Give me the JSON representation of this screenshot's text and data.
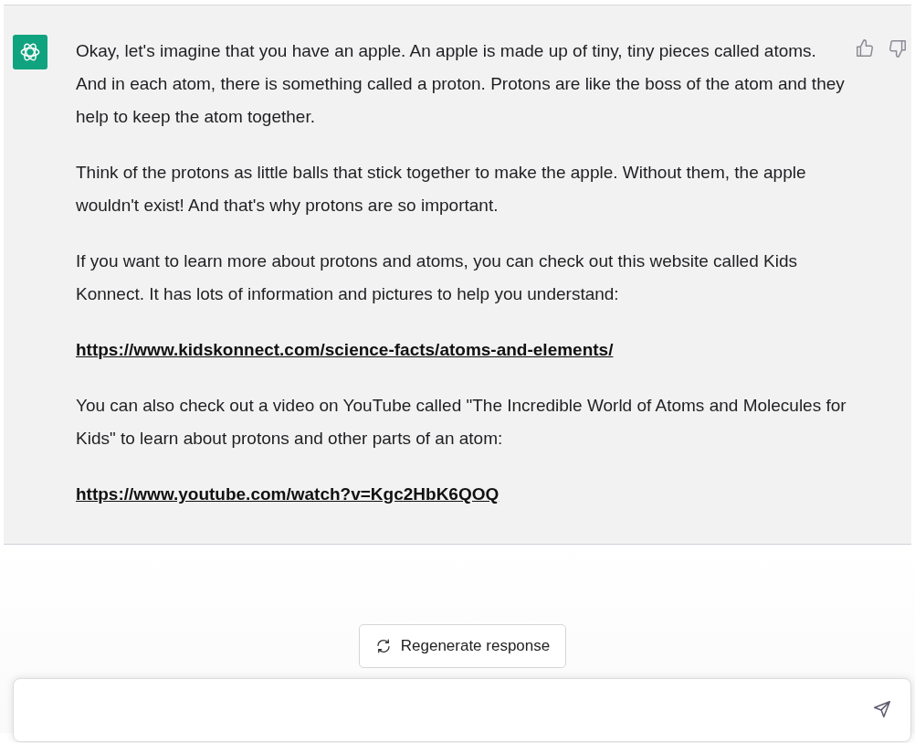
{
  "message": {
    "paragraphs": [
      {
        "kind": "text",
        "text": "Okay, let's imagine that you have an apple. An apple is made up of tiny, tiny pieces called atoms. And in each atom, there is something called a proton. Protons are like the boss of the atom and they help to keep the atom together."
      },
      {
        "kind": "text",
        "text": "Think of the protons as little balls that stick together to make the apple. Without them, the apple wouldn't exist! And that's why protons are so important."
      },
      {
        "kind": "text",
        "text": "If you want to learn more about protons and atoms, you can check out this website called Kids Konnect. It has lots of information and pictures to help you understand:"
      },
      {
        "kind": "link",
        "text": "https://www.kidskonnect.com/science-facts/atoms-and-elements/"
      },
      {
        "kind": "text",
        "text": "You can also check out a video on YouTube called \"The Incredible World of Atoms and Molecules for Kids\" to learn about protons and other parts of an atom:"
      },
      {
        "kind": "link",
        "text": "https://www.youtube.com/watch?v=Kgc2HbK6QOQ"
      }
    ]
  },
  "regenerate_button": {
    "label": "Regenerate response"
  }
}
